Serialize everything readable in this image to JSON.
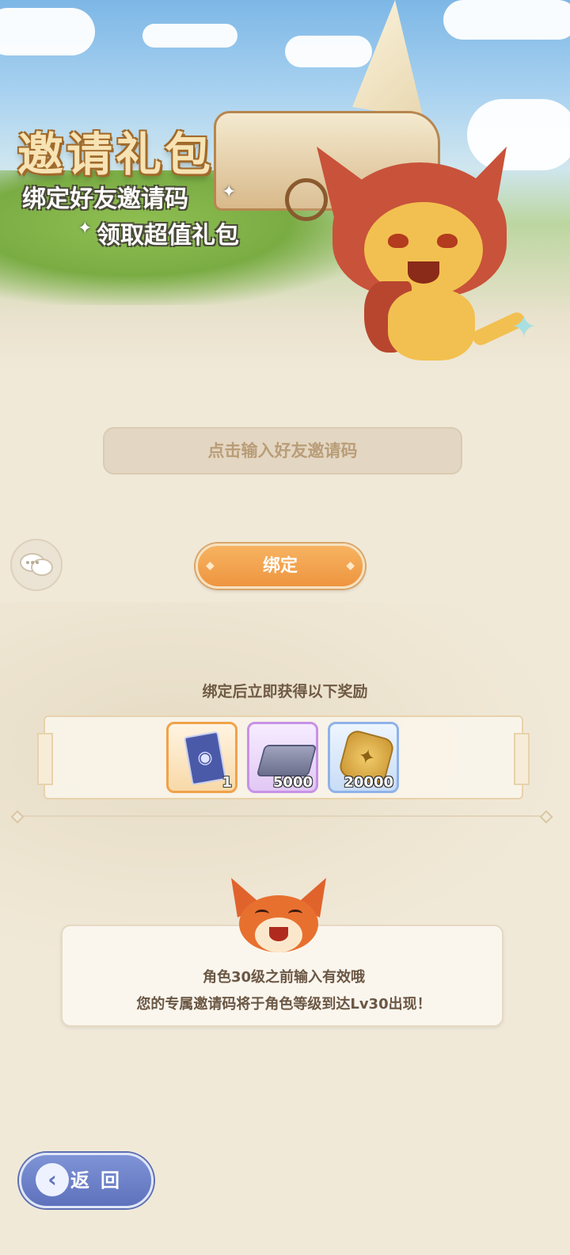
{
  "banner": {
    "title": "邀请礼包",
    "subtitle_line1": "绑定好友邀请码",
    "subtitle_line2": "领取超值礼包"
  },
  "invite": {
    "placeholder": "点击输入好友邀请码",
    "value": ""
  },
  "bind_button": {
    "label": "绑定"
  },
  "rewards": {
    "title": "绑定后立即获得以下奖励",
    "items": [
      {
        "icon": "card-icon",
        "count": "1",
        "frame_color": "#f0a24a"
      },
      {
        "icon": "silver-ingot-icon",
        "count": "5000",
        "frame_color": "#c792e6"
      },
      {
        "icon": "gold-coin-icon",
        "count": "20000",
        "frame_color": "#8fb2e8"
      }
    ]
  },
  "notice": {
    "line1": "角色30级之前输入有效哦",
    "line2": "您的专属邀请码将于角色等级到达Lv30出现！"
  },
  "back_button": {
    "label": "返回"
  },
  "colors": {
    "background": "#f1e9d8",
    "accent_orange": "#ee9540",
    "back_blue": "#5e72bd",
    "text_brown": "#6b5744"
  }
}
